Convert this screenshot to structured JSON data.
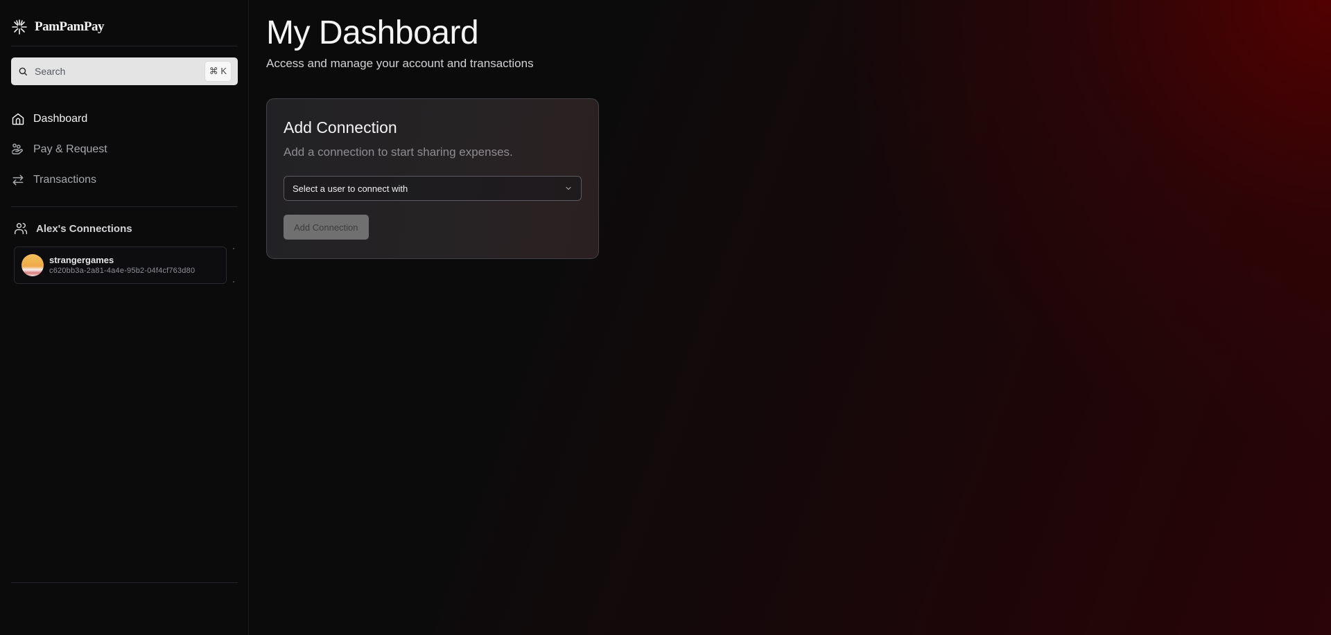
{
  "app": {
    "brand": "PamPamPay"
  },
  "sidebar": {
    "search": {
      "placeholder": "Search",
      "shortcut": "⌘ K"
    },
    "nav": [
      {
        "label": "Dashboard",
        "icon": "home-icon",
        "active": true
      },
      {
        "label": "Pay & Request",
        "icon": "hand-coins-icon",
        "active": false
      },
      {
        "label": "Transactions",
        "icon": "arrows-left-right-icon",
        "active": false
      }
    ],
    "connections": {
      "title": "Alex's Connections",
      "items": [
        {
          "username": "strangergames",
          "id": "c620bb3a-2a81-4a4e-95b2-04f4cf763d80"
        }
      ]
    }
  },
  "main": {
    "title": "My Dashboard",
    "subtitle": "Access and manage your account and transactions",
    "card": {
      "title": "Add Connection",
      "description": "Add a connection to start sharing expenses.",
      "select_placeholder": "Select a user to connect with",
      "button_label": "Add Connection",
      "button_disabled": true
    }
  },
  "colors": {
    "background": "#0b0b0c",
    "accent_glow": "#5a0000",
    "button_disabled_bg": "#707070"
  }
}
